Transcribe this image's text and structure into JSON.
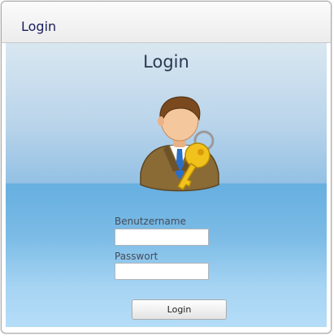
{
  "window": {
    "title": "Login"
  },
  "form": {
    "heading": "Login",
    "username": {
      "label": "Benutzername",
      "value": "",
      "placeholder": ""
    },
    "password": {
      "label": "Passwort",
      "value": "",
      "placeholder": ""
    },
    "submit_label": "Login"
  },
  "icons": {
    "avatar": "user-with-key-icon"
  },
  "colors": {
    "title_text": "#1a1e5c",
    "heading_text": "#2b3850",
    "panel_blue": "#66afe0"
  }
}
